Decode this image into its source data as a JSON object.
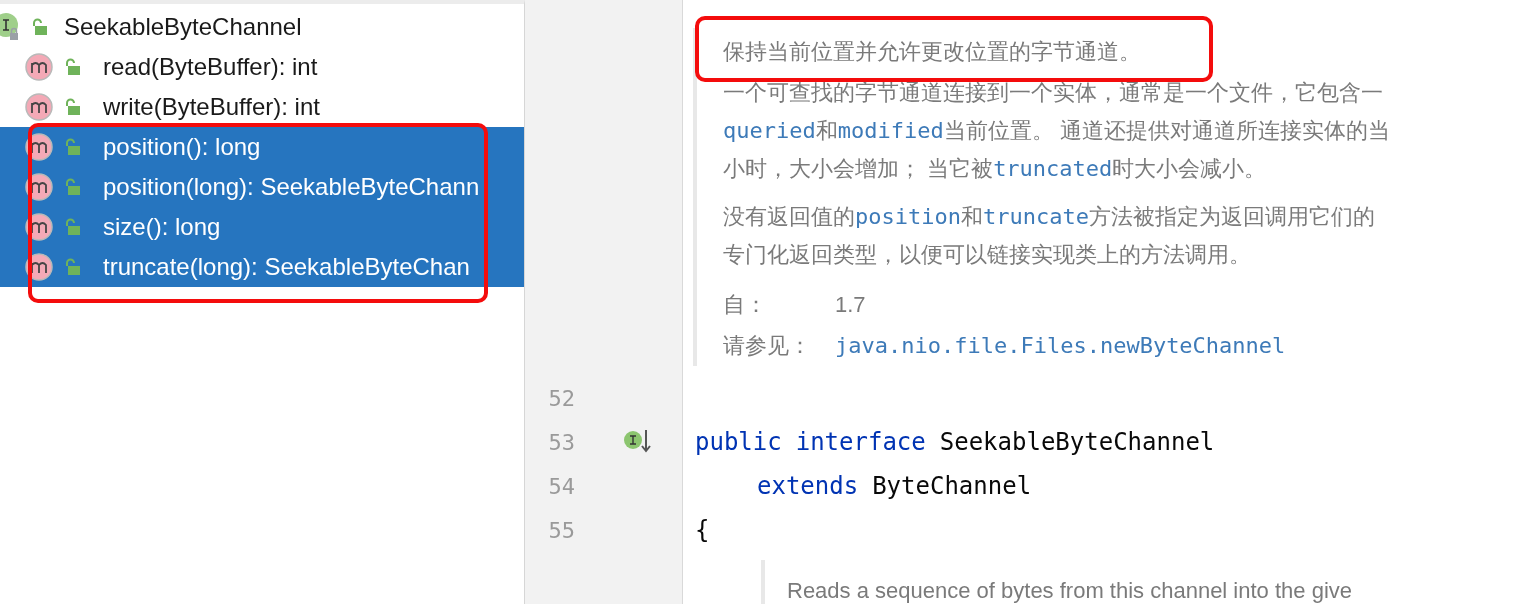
{
  "tree": {
    "label": "SeekableByteChannel",
    "selection_framed": true,
    "children": [
      {
        "label": "read(ByteBuffer): int",
        "selected": false
      },
      {
        "label": "write(ByteBuffer): int",
        "selected": false
      },
      {
        "label": "position(): long",
        "selected": true
      },
      {
        "label": "position(long): SeekableByteChann",
        "selected": true
      },
      {
        "label": "size(): long",
        "selected": true
      },
      {
        "label": "truncate(long): SeekableByteChan",
        "selected": true
      }
    ]
  },
  "doc": {
    "summary": "保持当前位置并允许更改位置的字节通道。",
    "summary_framed": true,
    "paragraphs": [
      [
        [
          {
            "kind": "text",
            "text": "一个可查找的字节通道连接到一个实体，通常是一个文件，它包含一"
          }
        ],
        [
          {
            "kind": "code",
            "text": "queried"
          },
          {
            "kind": "text",
            "text": "和"
          },
          {
            "kind": "code",
            "text": "modified"
          },
          {
            "kind": "text",
            "text": "当前位置。 通道还提供对通道所连接实体的当"
          }
        ],
        [
          {
            "kind": "text",
            "text": "小时，大小会增加； 当它被"
          },
          {
            "kind": "code",
            "text": "truncated"
          },
          {
            "kind": "text",
            "text": "时大小会减小。"
          }
        ]
      ],
      [
        [
          {
            "kind": "text",
            "text": "没有返回值的"
          },
          {
            "kind": "code",
            "text": "position"
          },
          {
            "kind": "text",
            "text": "和"
          },
          {
            "kind": "code",
            "text": "truncate"
          },
          {
            "kind": "text",
            "text": "方法被指定为返回调用它们的"
          }
        ],
        [
          {
            "kind": "text",
            "text": "专门化返回类型，以便可以链接实现类上的方法调用。"
          }
        ]
      ]
    ],
    "since_label": "自：",
    "since_value": "1.7",
    "see_label": "请参见：",
    "see_link": "java.nio.file.Files.newByteChannel"
  },
  "code": [
    {
      "number": "52"
    },
    {
      "number": "53",
      "gutter_icon": true,
      "indent": false,
      "tokens": [
        {
          "kind": "keyword",
          "text": "public"
        },
        {
          "kind": "keyword",
          "text": "interface"
        },
        {
          "kind": "plain",
          "text": "SeekableByteChannel"
        }
      ]
    },
    {
      "number": "54",
      "indent": true,
      "tokens": [
        {
          "kind": "keyword",
          "text": "extends"
        },
        {
          "kind": "plain",
          "text": "ByteChannel"
        }
      ]
    },
    {
      "number": "55",
      "indent": false,
      "tokens": [
        {
          "kind": "plain",
          "text": "{"
        }
      ]
    }
  ],
  "doc_bottom": "Reads a sequence of bytes from this channel into the give"
}
